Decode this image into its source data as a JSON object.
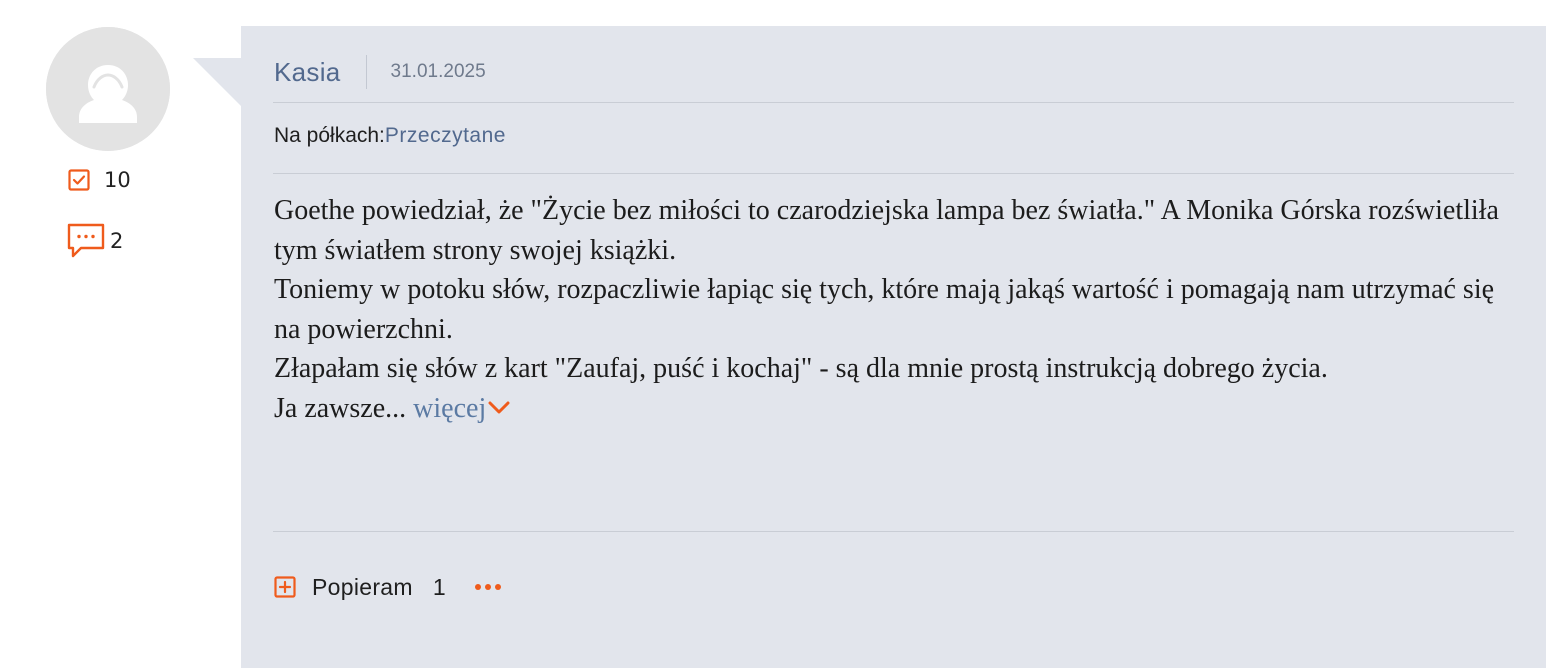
{
  "user": {
    "name": "Kasia",
    "ratings_count": "10",
    "comments_count": "2"
  },
  "review": {
    "date": "31.01.2025",
    "shelf_label": "Na półkach:",
    "shelf_name": "Przeczytane",
    "paragraphs": [
      "Goethe powiedział, że \"Życie bez miłości to czarodziejska lampa bez światła.\" A Monika Górska rozświetliła tym światłem strony swojej książki.",
      "Toniemy w potoku słów, rozpaczliwie łapiąc się tych, które mają jakąś wartość i pomagają nam utrzymać się na powierzchni.",
      "Złapałam się słów z kart \"Zaufaj, puść i kochaj\" - są dla mnie prostą instrukcją dobrego życia."
    ],
    "excerpt_tail": "Ja zawsze...",
    "more_label": "więcej"
  },
  "actions": {
    "support_label": "Popieram",
    "support_count": "1"
  },
  "icons": {
    "ratings": "checkbox-icon",
    "comments": "comment-icon",
    "more": "chevron-down-icon",
    "support": "plus-box-icon",
    "menu": "more-dots-icon"
  },
  "colors": {
    "accent": "#ef5b1c",
    "link": "#52698e",
    "card_bg": "#e2e5ec"
  }
}
